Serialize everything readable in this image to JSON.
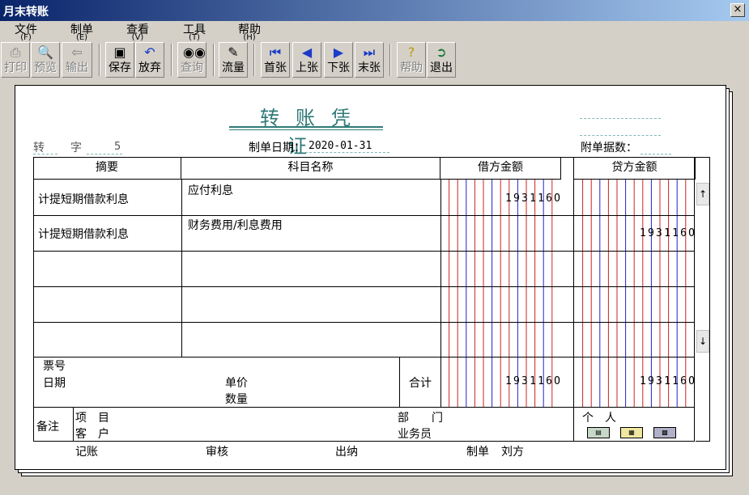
{
  "window": {
    "title": "月末转账",
    "close_label": "×"
  },
  "menu": [
    {
      "label": "文件",
      "accel": "(F)"
    },
    {
      "label": "制单",
      "accel": "(E)"
    },
    {
      "label": "查看",
      "accel": "(V)"
    },
    {
      "label": "工具",
      "accel": "(T)"
    },
    {
      "label": "帮助",
      "accel": "(H)"
    }
  ],
  "toolbar": {
    "print": "打印",
    "preview": "预览",
    "export": "输出",
    "save": "保存",
    "discard": "放弃",
    "query": "查询",
    "flow": "流量",
    "first": "首张",
    "prev": "上张",
    "next": "下张",
    "last": "末张",
    "help": "帮助",
    "exit": "退出"
  },
  "voucher": {
    "title": "转账凭证",
    "type_char": "转",
    "char_label": "字",
    "number": "5",
    "date_label": "制单日期：",
    "date": "2020-01-31",
    "attach_label": "附单据数：",
    "columns": {
      "summary": "摘要",
      "account": "科目名称",
      "debit": "借方金额",
      "credit": "贷方金额"
    },
    "rows": [
      {
        "summary": "计提短期借款利息",
        "account": "应付利息",
        "debit": "193116O",
        "credit": ""
      },
      {
        "summary": "计提短期借款利息",
        "account": "财务费用/利息费用",
        "debit": "",
        "credit": "193116O"
      },
      {
        "summary": "",
        "account": "",
        "debit": "",
        "credit": ""
      },
      {
        "summary": "",
        "account": "",
        "debit": "",
        "credit": ""
      },
      {
        "summary": "",
        "account": "",
        "debit": "",
        "credit": ""
      }
    ],
    "footer": {
      "ticket_no": "票号",
      "date": "日期",
      "unit_price": "单价",
      "quantity": "数量",
      "total_label": "合计",
      "total_debit": "193116O",
      "total_credit": "193116O",
      "remarks": "备注",
      "project": "项　目",
      "customer": "客　户",
      "department": "部　　门",
      "salesperson": "业务员",
      "individual": "个　人"
    },
    "signatures": {
      "bookkeeping": "记账",
      "audit": "审核",
      "cashier": "出纳",
      "maker_label": "制单",
      "maker": "刘方"
    }
  },
  "scroll": {
    "up": "↑",
    "down": "↓"
  },
  "colors": {
    "title_teal": "#2f7a78",
    "red_line": "#cc2222",
    "blue_line": "#2222cc"
  }
}
